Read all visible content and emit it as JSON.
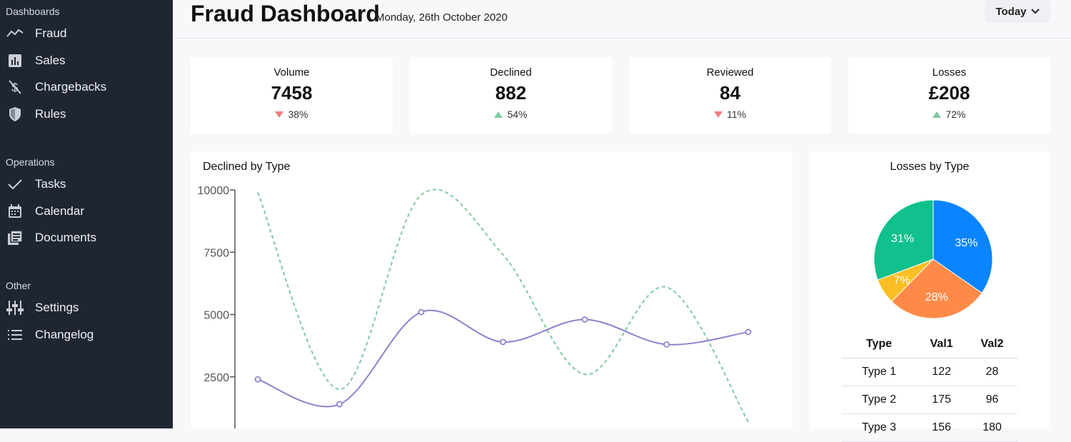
{
  "sidebar": {
    "sections": [
      {
        "title": "Dashboards",
        "items": [
          {
            "label": "Fraud",
            "icon": "trend-icon"
          },
          {
            "label": "Sales",
            "icon": "bar-chart-icon"
          },
          {
            "label": "Chargebacks",
            "icon": "no-dollar-icon"
          },
          {
            "label": "Rules",
            "icon": "shield-icon"
          }
        ]
      },
      {
        "title": "Operations",
        "items": [
          {
            "label": "Tasks",
            "icon": "check-icon"
          },
          {
            "label": "Calendar",
            "icon": "calendar-icon"
          },
          {
            "label": "Documents",
            "icon": "documents-icon"
          }
        ]
      },
      {
        "title": "Other",
        "items": [
          {
            "label": "Settings",
            "icon": "sliders-icon"
          },
          {
            "label": "Changelog",
            "icon": "list-icon"
          }
        ]
      }
    ]
  },
  "header": {
    "title": "Fraud Dashboard",
    "date": "Monday, 26th October 2020",
    "range_label": "Today"
  },
  "kpis": [
    {
      "label": "Volume",
      "value": "7458",
      "change": "38%",
      "direction": "down"
    },
    {
      "label": "Declined",
      "value": "882",
      "change": "54%",
      "direction": "up"
    },
    {
      "label": "Reviewed",
      "value": "84",
      "change": "11%",
      "direction": "down"
    },
    {
      "label": "Losses",
      "value": "£208",
      "change": "72%",
      "direction": "up"
    }
  ],
  "colors": {
    "sidebar_bg": "#1f2631",
    "down": "#ef7f7f",
    "up": "#7fcaa0",
    "line_solid": "#8f81cf",
    "line_dashed": "#7fc9a0",
    "pie_blue": "#0a84ff",
    "pie_orange": "#ff8a47",
    "pie_yellow": "#fbbf24",
    "pie_green": "#10c08d"
  },
  "declined_chart": {
    "title": "Declined by Type"
  },
  "losses_chart": {
    "title": "Losses by Type"
  },
  "chart_data": [
    {
      "type": "line",
      "title": "Declined by Type",
      "y_ticks": [
        "10000",
        "7500",
        "5000",
        "2500"
      ],
      "ylim": [
        0,
        10000
      ],
      "x": [
        1,
        2,
        3,
        4,
        5,
        6,
        7
      ],
      "series": [
        {
          "style": "solid",
          "values": [
            2400,
            1400,
            5100,
            3900,
            4800,
            3800,
            4300
          ]
        },
        {
          "style": "dashed",
          "values": [
            9900,
            2000,
            9800,
            7400,
            2600,
            6100,
            700
          ]
        }
      ],
      "grid": false
    },
    {
      "type": "pie",
      "title": "Losses by Type",
      "slices": [
        {
          "label": "35%",
          "value": 35,
          "color": "#0a84ff"
        },
        {
          "label": "28%",
          "value": 28,
          "color": "#ff8a47"
        },
        {
          "label": "7%",
          "value": 7,
          "color": "#fbbf24"
        },
        {
          "label": "31%",
          "value": 31,
          "color": "#10c08d"
        }
      ]
    }
  ],
  "losses_table": {
    "headers": [
      "Type",
      "Val1",
      "Val2"
    ],
    "rows": [
      [
        "Type 1",
        "122",
        "28"
      ],
      [
        "Type 2",
        "175",
        "96"
      ],
      [
        "Type 3",
        "156",
        "180"
      ]
    ]
  }
}
